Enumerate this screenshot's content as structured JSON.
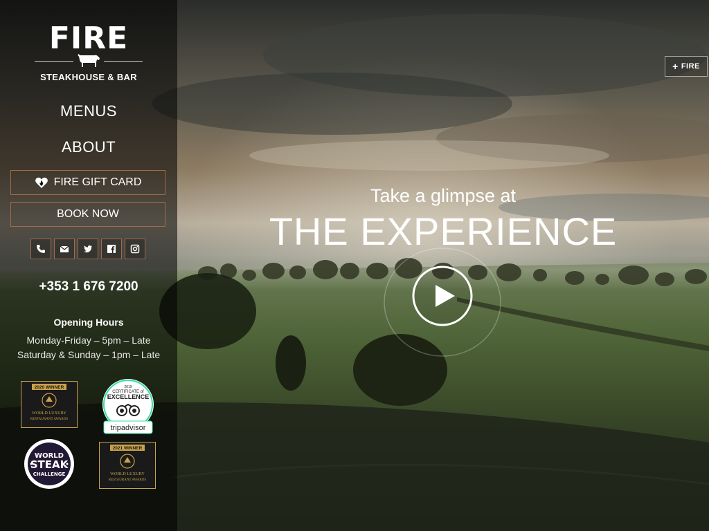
{
  "brand": {
    "logo_word": "FIRE",
    "logo_sub": "STEAKHOUSE & BAR"
  },
  "nav": {
    "menus": "MENUS",
    "about": "ABOUT",
    "gift_card": "FIRE GIFT CARD",
    "book_now": "BOOK NOW"
  },
  "socials": [
    {
      "icon": "phone-icon"
    },
    {
      "icon": "email-icon"
    },
    {
      "icon": "twitter-icon"
    },
    {
      "icon": "facebook-icon"
    },
    {
      "icon": "instagram-icon"
    }
  ],
  "contact": {
    "phone": "+353 1 676 7200"
  },
  "hours": {
    "title": "Opening Hours",
    "weekday": "Monday-Friday – 5pm – Late",
    "weekend": "Saturday & Sunday – 1pm – Late"
  },
  "awards": {
    "wlra_2020_ribbon": "2020 WINNER",
    "wlra_2021_ribbon": "2021 WINNER",
    "wlra_text": "WORLD LUXURY RESTAURANT AWARDS",
    "trip_year": "2019",
    "trip_cert": "CERTIFICATE of",
    "trip_excellence": "EXCELLENCE",
    "trip_brand": "tripadvisor",
    "wsc_line1": "WORLD",
    "wsc_line2": "STEAK",
    "wsc_line3": "CHALLENGE"
  },
  "hero": {
    "tagline": "Take a glimpse at",
    "title": "THE EXPERIENCE"
  },
  "corner": {
    "plus": "+",
    "label": "FIRE"
  },
  "colors": {
    "button_border": "#a06b4b",
    "gold": "#c9a24a",
    "trip_green": "#34e0a1"
  }
}
